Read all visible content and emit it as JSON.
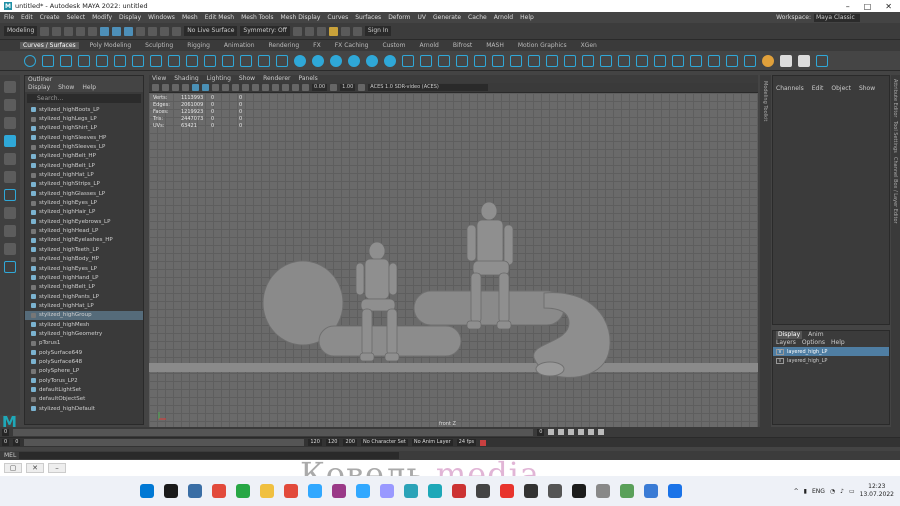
{
  "title": "untitled* - Autodesk MAYA 2022: untitled",
  "window_controls": [
    "–",
    "□",
    "✕"
  ],
  "menu": [
    "File",
    "Edit",
    "Create",
    "Select",
    "Modify",
    "Display",
    "Windows",
    "Mesh",
    "Edit Mesh",
    "Mesh Tools",
    "Mesh Display",
    "Curves",
    "Surfaces",
    "Deform",
    "UV",
    "Generate",
    "Cache",
    "Arnold",
    "Help"
  ],
  "workspace": {
    "label": "Workspace:",
    "value": "Maya Classic"
  },
  "statusline": {
    "mode": "Modeling",
    "live": "No Live Surface",
    "symmetry": "Symmetry: Off",
    "signin": "Sign In"
  },
  "shelf_tabs": [
    "Curves / Surfaces",
    "Poly Modeling",
    "Sculpting",
    "Rigging",
    "Animation",
    "Rendering",
    "FX",
    "FX Caching",
    "Custom",
    "Arnold",
    "Bifrost",
    "MASH",
    "Motion Graphics",
    "XGen"
  ],
  "shelf_active": 0,
  "outliner": {
    "title": "Outliner",
    "menu": [
      "Display",
      "Show",
      "Help"
    ],
    "search_placeholder": "Search...",
    "items": [
      "stylized_highBoots_LP",
      "stylized_highLegs_LP",
      "stylized_highShirt_LP",
      "stylized_highSleeves_HP",
      "stylized_highSleeves_LP",
      "stylized_highBelt_HP",
      "stylized_highBelt_LP",
      "stylized_highHat_LP",
      "stylized_highStrips_LP",
      "stylized_highGlasses_LP",
      "stylized_highEyes_LP",
      "stylized_highHair_LP",
      "stylized_highEyebrows_LP",
      "stylized_highHead_LP",
      "stylized_highEyelashes_HP",
      "stylized_highTeeth_LP",
      "stylized_highBody_HP",
      "stylized_highEyes_LP",
      "stylized_highHand_LP",
      "stylized_highBelt_LP",
      "stylized_highPants_LP",
      "stylized_highHat_LP",
      "stylized_highGroup",
      "stylized_highMesh",
      "stylized_highGeometry",
      "pTorus1",
      "polySurface649",
      "polySurface648",
      "polySphere_LP",
      "polyTorus_LP2",
      "defaultLightSet",
      "defaultObjectSet",
      "stylized_highDefault"
    ],
    "selected_index": 22
  },
  "viewport": {
    "menu": [
      "View",
      "Shading",
      "Lighting",
      "Show",
      "Renderer",
      "Panels"
    ],
    "exposure": "0.00",
    "gamma": "1.00",
    "colorspace": "ACES 1.0 SDR-video (ACES)",
    "hud": [
      {
        "label": "Verts:",
        "v1": "1113993",
        "v2": "0",
        "v3": "0"
      },
      {
        "label": "Edges:",
        "v1": "2061009",
        "v2": "0",
        "v3": "0"
      },
      {
        "label": "Faces:",
        "v1": "1219923",
        "v2": "0",
        "v3": "0"
      },
      {
        "label": "Tris:",
        "v1": "2447073",
        "v2": "0",
        "v3": "0"
      },
      {
        "label": "UVs:",
        "v1": "63421",
        "v2": "0",
        "v3": "0"
      }
    ],
    "camera": "front Z"
  },
  "right_strip": "Modeling Toolkit",
  "channelbox": {
    "menu": [
      "Channels",
      "Edit",
      "Object",
      "Show"
    ]
  },
  "right_edge_tabs": [
    "Attribute Editor",
    "Tool Settings",
    "Channel Box / Layer Editor",
    "Outliner"
  ],
  "layers": {
    "tabs": [
      "Display",
      "Anim"
    ],
    "menu": [
      "Layers",
      "Options",
      "Help"
    ],
    "rows": [
      {
        "vis": "V",
        "name": "layered_high_LP",
        "selected": true
      },
      {
        "vis": "V",
        "name": "layered_high_LP",
        "selected": false
      }
    ]
  },
  "timeslider": {
    "start": "0",
    "current": "0",
    "end_marker": "120"
  },
  "rangeslider": {
    "start": "0",
    "anim_start": "0",
    "anim_end": "120",
    "end": "120",
    "max": "200",
    "char_set": "No Character Set",
    "anim_layer": "No Anim Layer",
    "fps": "24 fps"
  },
  "cmdline": {
    "label": "MEL"
  },
  "watermark": {
    "part1": "Ковель",
    "part2": "media"
  },
  "taskbar": {
    "lang": "ENG",
    "time": "12:23",
    "date": "13.07.2022",
    "apps": [
      "#0078d4",
      "#1a1a1a",
      "#3a6ea5",
      "#e24a3b",
      "#27a745",
      "#f0c040",
      "#e24a3b",
      "#31a8ff",
      "#9a3a88",
      "#31a8ff",
      "#9999ff",
      "#2ba3b8",
      "#1ea8b8",
      "#cc3333",
      "#444444",
      "#e8342d",
      "#333333",
      "#555555",
      "#1c1c1c",
      "#888888",
      "#5aa05a",
      "#3a7bd5",
      "#1a73e8"
    ]
  }
}
